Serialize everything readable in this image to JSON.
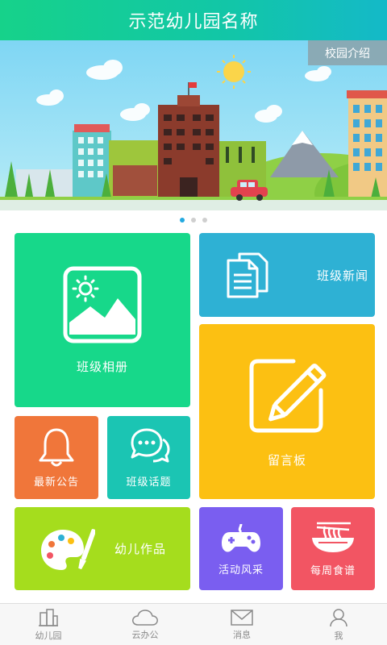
{
  "header": {
    "title": "示范幼儿园名称"
  },
  "banner": {
    "button_label": "校园介绍",
    "dots": 3,
    "active_dot": 0
  },
  "tiles": {
    "class_album": "班级相册",
    "class_news": "班级新闻",
    "message_board": "留言板",
    "latest_notice": "最新公告",
    "class_topics": "班级话题",
    "kids_works": "幼儿作品",
    "activities": "活动风采",
    "weekly_menu": "每周食谱"
  },
  "colors": {
    "header": "#16d28a",
    "album": "#17d88a",
    "news": "#2eb1d4",
    "message": "#fcc012",
    "notice": "#f0763a",
    "topics": "#1bc5b3",
    "works": "#a5dd1d",
    "activities": "#7a5ef0",
    "menu": "#f25563",
    "nav_active": "#23a9e0"
  },
  "bottom_nav": [
    {
      "label": "幼儿园",
      "icon": "kindergarten-icon"
    },
    {
      "label": "云办公",
      "icon": "cloud-icon"
    },
    {
      "label": "消息",
      "icon": "mail-icon"
    },
    {
      "label": "我",
      "icon": "user-icon"
    }
  ]
}
